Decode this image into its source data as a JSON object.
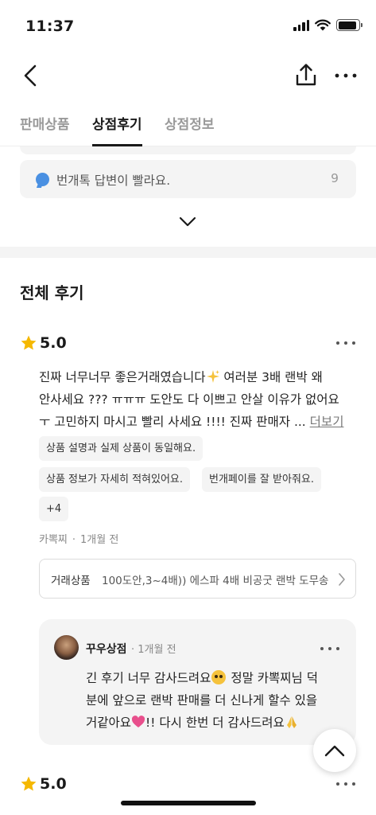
{
  "status_bar": {
    "time": "11:37",
    "battery_level": 0.9
  },
  "nav": {
    "back_icon": "chevron-left-icon",
    "share_icon": "share-icon",
    "more_icon": "more-horizontal-icon"
  },
  "tabs": [
    {
      "label": "판매상품",
      "active": false
    },
    {
      "label": "상점후기",
      "active": true
    },
    {
      "label": "상점정보",
      "active": false
    }
  ],
  "keyword_summary": {
    "text": "번개톡 답변이 빨라요.",
    "count": "9",
    "icon": "chat-bubble-icon",
    "icon_color": "#4a90e2"
  },
  "section_title": "전체 후기",
  "reviews": [
    {
      "rating": "5.0",
      "body_lines": [
        "진짜 너무너무 좋은거래였습니다",
        " 여러분 3배 랜박 왜",
        "안사세요 ??? ㅠㅠㅠ 도안도 다 이쁘고 안살 이유가 없어요",
        "ㅜ 고민하지 마시고 빨리 사세요 !!!! 진짜 판매자 ... "
      ],
      "more_link": "더보기",
      "tags": [
        "상품 설명과 실제 상품이 동일해요.",
        "상품 정보가 자세히 적혀있어요.",
        "번개페이를 잘 받아줘요.",
        "+4"
      ],
      "author": "카뽁찌",
      "time": "1개월 전",
      "product_label": "거래상품",
      "product_name": "100도안,3~4배)) 에스파 4배 비공굿 랜박 도무송",
      "reply": {
        "author": "꾸우상점",
        "time": "1개월 전",
        "line1": "긴 후기 너무 감사드려요",
        "line1_after": " 정말 카뽁찌님 덕",
        "line2": "분에 앞으로 랜박 판매를 더 신나게 할수 있을",
        "line3": "거같아요",
        "line3_after": "!! 다시 한번 더 감사드려요"
      }
    },
    {
      "rating": "5.0"
    }
  ],
  "colors": {
    "star": "#f5b800",
    "accent_blue": "#4a90e2",
    "heart": "#e84f8c"
  }
}
